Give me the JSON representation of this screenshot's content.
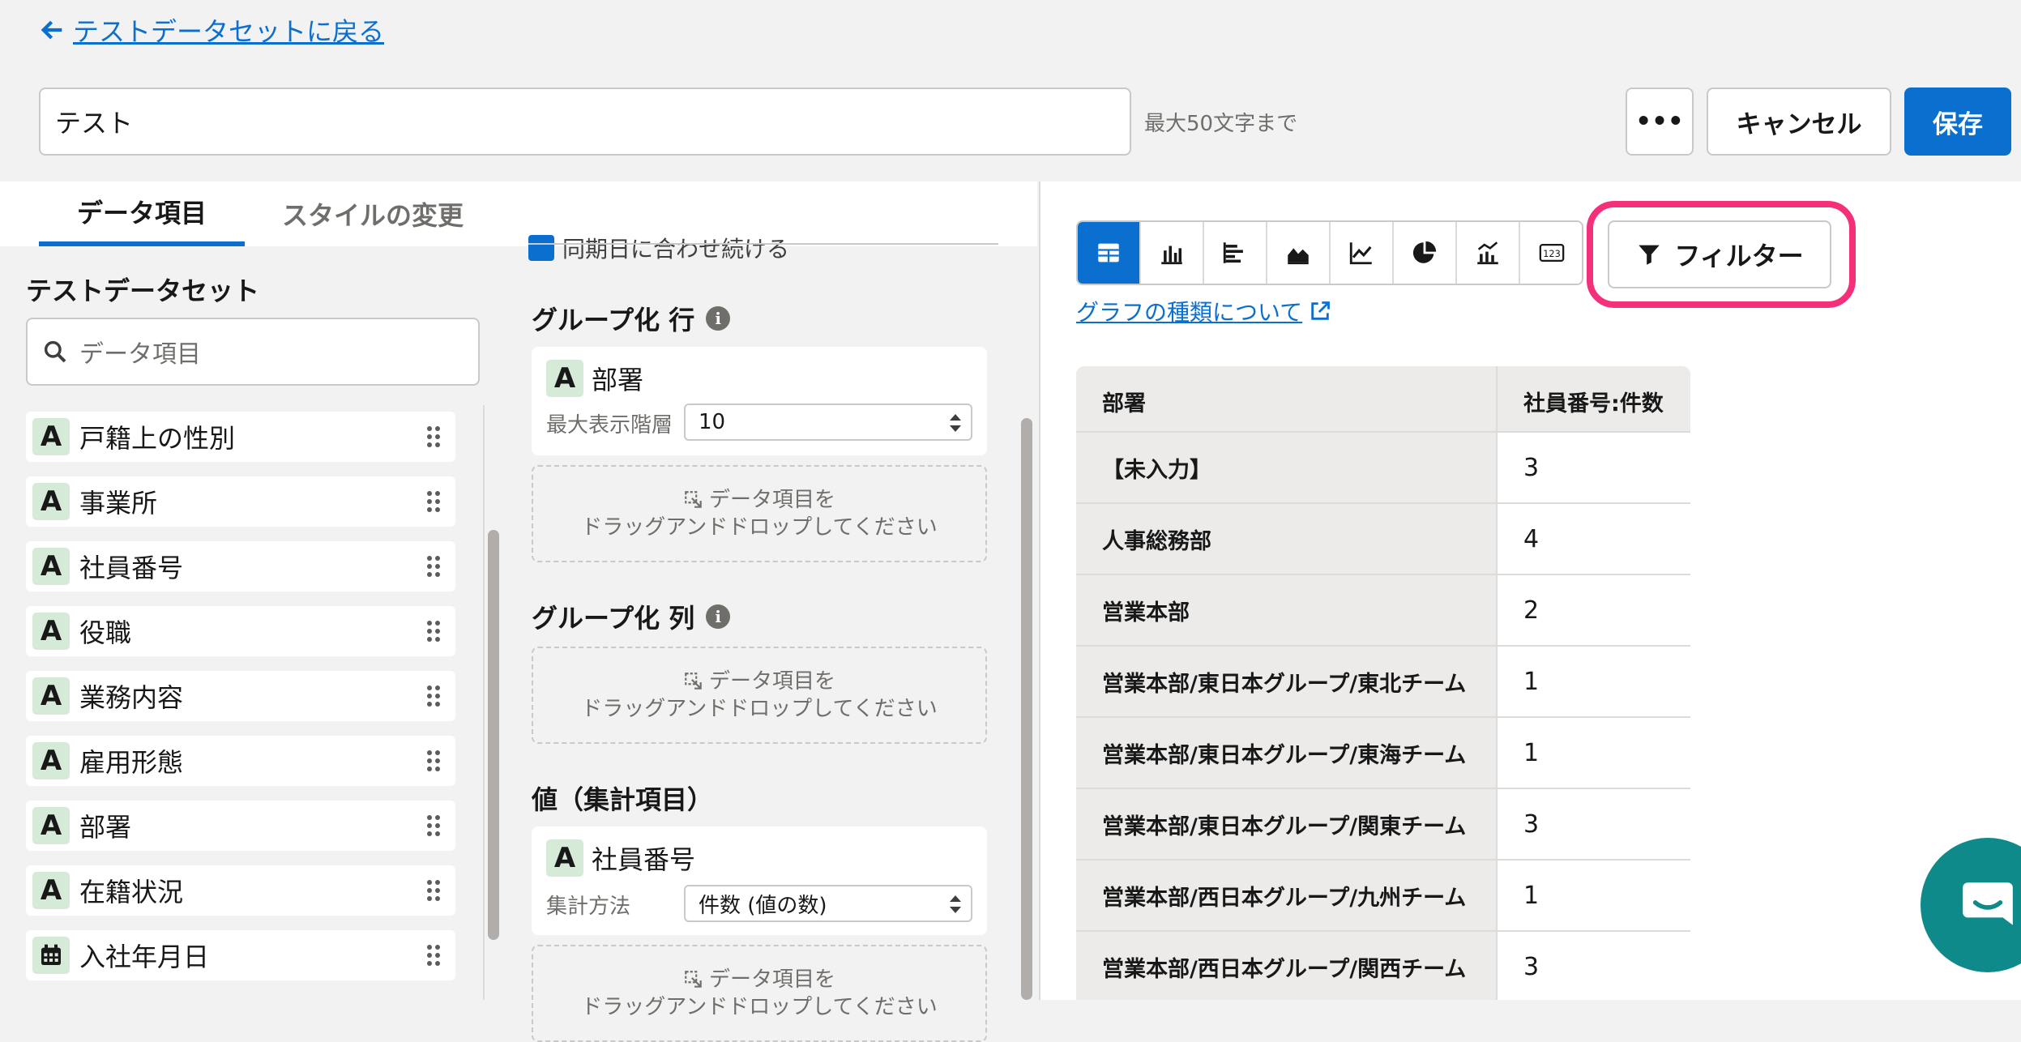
{
  "header": {
    "back_link": "テストデータセットに戻る",
    "title_value": "テスト",
    "max_length_hint": "最大50文字まで",
    "more_label": "•••",
    "cancel_label": "キャンセル",
    "save_label": "保存"
  },
  "tabs": {
    "data_items": "データ項目",
    "style_change": "スタイルの変更"
  },
  "left_panel": {
    "dataset_title": "テストデータセット",
    "search_placeholder": "データ項目",
    "fields": [
      {
        "type": "A",
        "name": "戸籍上の性別"
      },
      {
        "type": "A",
        "name": "事業所"
      },
      {
        "type": "A",
        "name": "社員番号"
      },
      {
        "type": "A",
        "name": "役職"
      },
      {
        "type": "A",
        "name": "業務内容"
      },
      {
        "type": "A",
        "name": "雇用形態"
      },
      {
        "type": "A",
        "name": "部署"
      },
      {
        "type": "A",
        "name": "在籍状況"
      },
      {
        "type": "calendar",
        "name": "入社年月日"
      }
    ]
  },
  "config": {
    "partial_checkbox_label": "同期日に合わせ続ける",
    "group_rows": {
      "title": "グループ化 行",
      "item": {
        "type": "A",
        "name": "部署"
      },
      "max_level_label": "最大表示階層",
      "max_level_value": "10"
    },
    "group_cols": {
      "title": "グループ化 列"
    },
    "values": {
      "title": "値（集計項目）",
      "item": {
        "type": "A",
        "name": "社員番号"
      },
      "agg_label": "集計方法",
      "agg_value": "件数 (値の数)"
    },
    "dropzone": {
      "line1": "データ項目を",
      "line2": "ドラッグアンドドロップしてください"
    }
  },
  "right_panel": {
    "chart_types": [
      "table",
      "bar-vertical",
      "bar-horizontal",
      "area",
      "line",
      "pie",
      "combo",
      "number"
    ],
    "active_chart": "table",
    "filter_label": "フィルター",
    "chart_link": "グラフの種類について",
    "highlight_color": "#f5307a",
    "table": {
      "headers": [
        "部署",
        "社員番号:件数"
      ],
      "rows": [
        [
          "【未入力】",
          "3"
        ],
        [
          "人事総務部",
          "4"
        ],
        [
          "営業本部",
          "2"
        ],
        [
          "営業本部/東日本グループ/東北チーム",
          "1"
        ],
        [
          "営業本部/東日本グループ/東海チーム",
          "1"
        ],
        [
          "営業本部/東日本グループ/関東チーム",
          "3"
        ],
        [
          "営業本部/西日本グループ/九州チーム",
          "1"
        ],
        [
          "営業本部/西日本グループ/関西チーム",
          "3"
        ]
      ]
    }
  },
  "colors": {
    "accent": "#0b6fd0",
    "badge_bg": "#d6ebd7",
    "chat": "#0e8a8a"
  }
}
